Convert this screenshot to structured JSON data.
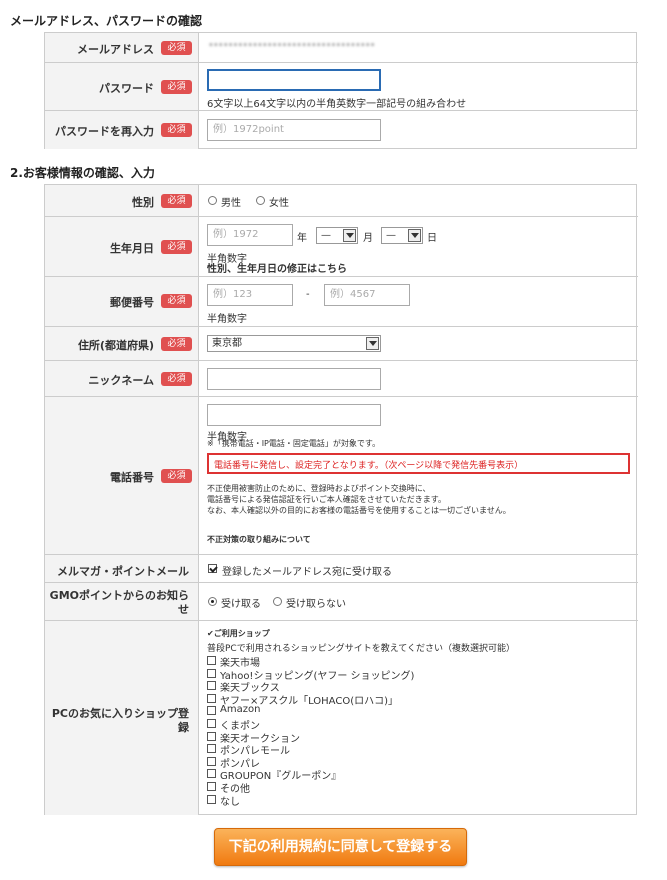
{
  "section1": {
    "title": "メールアドレス、パスワードの確認",
    "email_label": "メールアドレス",
    "email_value": "••••••••••••••••••••••••••••••••••",
    "password_label": "パスワード",
    "password_hint": "6文字以上64文字以内の半角英数字一部記号の組み合わせ",
    "password_confirm_label": "パスワードを再入力",
    "password_confirm_placeholder": "例）1972point"
  },
  "required_badge": "必須",
  "section2": {
    "title": "2.お客様情報の確認、入力",
    "gender_label": "性別",
    "gender_options": [
      "男性",
      "女性"
    ],
    "birth_label": "生年月日",
    "birth_year_placeholder": "例）1972",
    "year_unit": "年",
    "month_value": "—",
    "month_unit": "月",
    "day_value": "—",
    "day_unit": "日",
    "birth_note": "半角数字",
    "birth_link": "性別、生年月日の修正はこちら",
    "postal_label": "郵便番号",
    "postal1_placeholder": "例）123",
    "postal_sep": "-",
    "postal2_placeholder": "例）4567",
    "postal_note": "半角数字",
    "pref_label": "住所(都道府県)",
    "pref_value": "東京都",
    "nickname_label": "ニックネーム",
    "phone_label": "電話番号",
    "phone_note": "半角数字",
    "phone_target": "※「携帯電話・IP電話・固定電話」が対象です。",
    "phone_notice": "電話番号に発信し、設定完了となります。（次ページ以降で発信先番号表示）",
    "phone_desc1": "不正使用被害防止のために、登録時およびポイント交換時に、",
    "phone_desc2": "電話番号による発信認証を行いご本人確認をさせていただきます。",
    "phone_desc3": "なお、本人確認以外の目的にお客様の電話番号を使用することは一切ございません。",
    "phone_link": "不正対策の取り組みについて",
    "mailmag_label": "メルマガ・ポイントメール",
    "mailmag_option": "登録したメールアドレス宛に受け取る",
    "gmo_label_1": "GMOポイントからのお知ら",
    "gmo_label_2": "せ",
    "gmo_options": [
      "受け取る",
      "受け取らない"
    ],
    "shop_label_1": "PCのお気に入りショップ登",
    "shop_label_2": "録",
    "shop_heading": "ご利用ショップ",
    "shop_desc": "普段PCで利用されるショッピングサイトを教えてください（複数選択可能）",
    "shops": [
      "楽天市場",
      "Yahoo!ショッピング(ヤフー ショッピング)",
      "楽天ブックス",
      "ヤフー×アスクル「LOHACO(ロハコ)」",
      "Amazon",
      "くまポン",
      "楽天オークション",
      "ポンパレモール",
      "ポンパレ",
      "GROUPON『グルーポン』",
      "その他",
      "なし"
    ]
  },
  "submit_label": "下記の利用規約に同意して登録する"
}
